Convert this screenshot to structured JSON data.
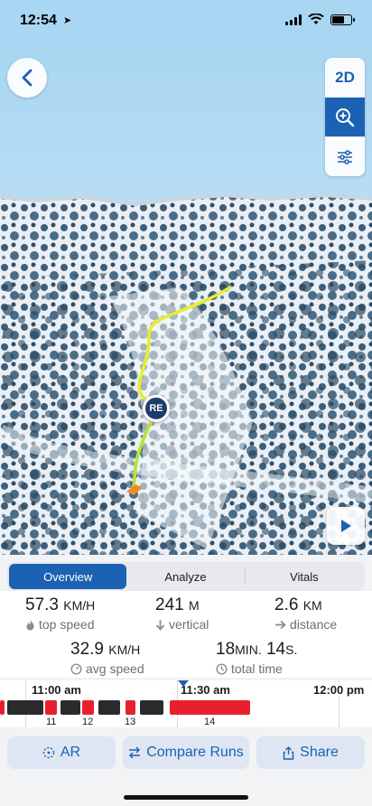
{
  "status_bar": {
    "time": "12:54"
  },
  "map": {
    "controls": {
      "mode_2d_label": "2D"
    },
    "marker_label": "RE"
  },
  "tabs": [
    {
      "label": "Overview",
      "active": true
    },
    {
      "label": "Analyze",
      "active": false
    },
    {
      "label": "Vitals",
      "active": false
    }
  ],
  "stats": {
    "top_speed": {
      "value": "57.3",
      "unit": "KM/H",
      "label": "top speed",
      "icon": "flame-icon"
    },
    "vertical": {
      "value": "241",
      "unit": "M",
      "label": "vertical",
      "icon": "arrow-down-icon"
    },
    "distance": {
      "value": "2.6",
      "unit": "KM",
      "label": "distance",
      "icon": "arrow-right-icon"
    },
    "avg_speed": {
      "value": "32.9",
      "unit": "KM/H",
      "label": "avg speed",
      "icon": "speedometer-icon"
    },
    "total_time": {
      "value_min": "18",
      "unit_min": "MIN.",
      "value_sec": "14",
      "unit_sec": "S.",
      "label": "total time",
      "icon": "clock-icon"
    }
  },
  "timeline": {
    "times": [
      "11:00 am",
      "11:30 am",
      "12:00 pm"
    ],
    "run_numbers": [
      "11",
      "12",
      "13",
      "14"
    ]
  },
  "actions": {
    "ar": "AR",
    "compare": "Compare Runs",
    "share": "Share"
  },
  "colors": {
    "accent": "#1b62b3",
    "run_red": "#e8202e",
    "lift_dark": "#2b2b2e",
    "track_yellow": "#e6ee2c",
    "track_green": "#b7e33a"
  }
}
